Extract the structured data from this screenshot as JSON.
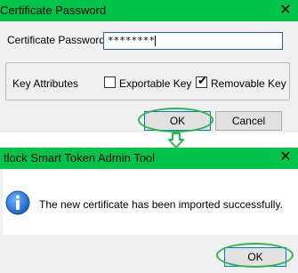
{
  "dialog1": {
    "title": "Certificate Password",
    "close_glyph": "✕",
    "password_label": "Certificate Password",
    "password_value": "********",
    "key_attributes_label": "Key Attributes",
    "exportable_label": "Exportable Key",
    "exportable_checked": false,
    "removable_label": "Removable Key",
    "removable_checked": true,
    "ok_label": "OK",
    "cancel_label": "Cancel"
  },
  "dialog2": {
    "title": "tlock Smart Token Admin Tool",
    "close_glyph": "✕",
    "message": "The new certificate has been imported successfully.",
    "ok_label": "OK",
    "icon": "info-icon"
  },
  "colors": {
    "titlebar": "#00c44a",
    "highlight": "#2ab54a",
    "dialog_bg": "#f0f0f0"
  }
}
